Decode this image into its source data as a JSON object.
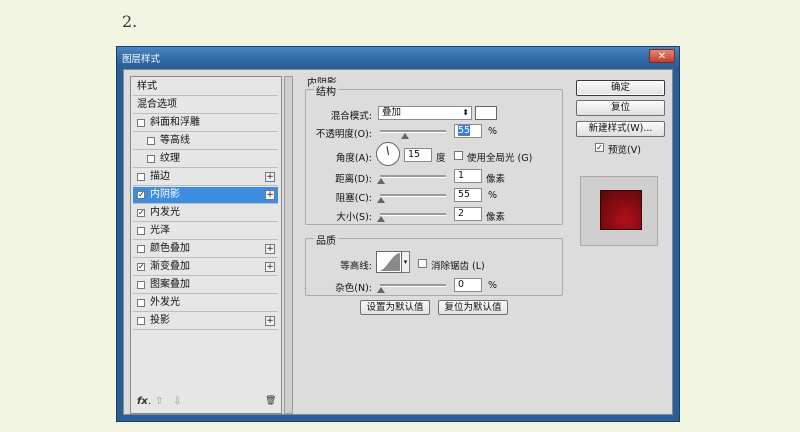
{
  "step_number": "2.",
  "window": {
    "title": "图层样式",
    "close_glyph": "✕"
  },
  "styles_list": {
    "items": [
      {
        "label": "样式",
        "kind": "header"
      },
      {
        "label": "混合选项",
        "kind": "header"
      },
      {
        "label": "斜面和浮雕",
        "checked": false,
        "indent": 0
      },
      {
        "label": "等高线",
        "checked": false,
        "indent": 1
      },
      {
        "label": "纹理",
        "checked": false,
        "indent": 1
      },
      {
        "label": "描边",
        "checked": false,
        "indent": 0,
        "plus": true
      },
      {
        "label": "内阴影",
        "checked": true,
        "indent": 0,
        "plus": true,
        "selected": true
      },
      {
        "label": "内发光",
        "checked": true,
        "indent": 0
      },
      {
        "label": "光泽",
        "checked": false,
        "indent": 0
      },
      {
        "label": "颜色叠加",
        "checked": false,
        "indent": 0,
        "plus": true
      },
      {
        "label": "渐变叠加",
        "checked": true,
        "indent": 0,
        "plus": true
      },
      {
        "label": "图案叠加",
        "checked": false,
        "indent": 0
      },
      {
        "label": "外发光",
        "checked": false,
        "indent": 0
      },
      {
        "label": "投影",
        "checked": false,
        "indent": 0,
        "plus": true
      }
    ],
    "footer": {
      "fx": "fx",
      "fx_dot": ".",
      "up": "⇧",
      "down": "⇩",
      "trash": "🗑"
    }
  },
  "inner_shadow": {
    "section_title": "内阴影",
    "structure": {
      "legend": "结构",
      "blend_mode_label": "混合模式:",
      "blend_mode_value": "叠加",
      "opacity_label": "不透明度(O):",
      "opacity_value": "55",
      "opacity_unit": "%",
      "angle_label": "角度(A):",
      "angle_value": "15",
      "angle_unit": "度",
      "global_light_label": "使用全局光 (G)",
      "global_light_checked": false,
      "distance_label": "距离(D):",
      "distance_value": "1",
      "distance_unit": "像素",
      "choke_label": "阻塞(C):",
      "choke_value": "55",
      "choke_unit": "%",
      "size_label": "大小(S):",
      "size_value": "2",
      "size_unit": "像素",
      "arrow_glyph": "⬍"
    },
    "quality": {
      "legend": "品质",
      "contour_label": "等高线:",
      "antialias_label": "消除锯齿 (L)",
      "antialias_checked": false,
      "noise_label": "杂色(N):",
      "noise_value": "0",
      "noise_unit": "%",
      "dd_glyph": "▾"
    },
    "make_default_label": "设置为默认值",
    "reset_default_label": "复位为默认值"
  },
  "right_panel": {
    "ok_label": "确定",
    "reset_label": "复位",
    "new_style_label": "新建样式(W)...",
    "preview_label": "预览(V)",
    "preview_checked": true,
    "check_glyph": "✓"
  }
}
